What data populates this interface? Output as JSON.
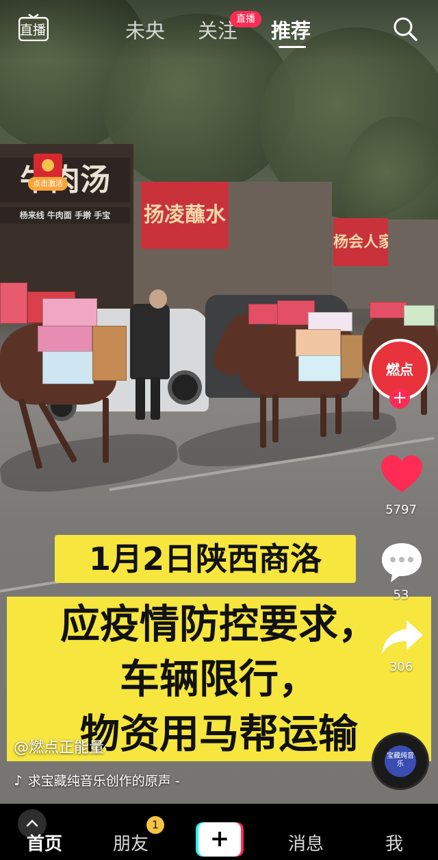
{
  "top_nav": {
    "live_tab_label": "直播",
    "tabs": [
      {
        "label": "未央"
      },
      {
        "label": "关注",
        "badge": "直播"
      },
      {
        "label": "推荐"
      }
    ],
    "active_tab": "推荐"
  },
  "video": {
    "store_signs": [
      "牛肉汤",
      "扬凌蘸水",
      "杨会人家"
    ],
    "store_subtext": "杨来线  牛肉面  手擀  手宝",
    "red_packet_tag": "点击激活",
    "caption_line1": "1月2日陕西商洛",
    "caption_lines": [
      "应疫情防控要求，",
      "车辆限行，",
      "物资用马帮运输"
    ]
  },
  "sidebar": {
    "author_avatar_text": "燃点",
    "likes": "5797",
    "comments": "53",
    "shares": "306",
    "music_disc_text": "宝藏纯音乐"
  },
  "info": {
    "author": "@燃点正能量",
    "music": "求宝藏纯音乐创作的原声 -"
  },
  "bottom_nav": {
    "tabs": [
      "首页",
      "朋友",
      "消息",
      "我"
    ],
    "friends_badge": "1",
    "active_tab": "首页"
  },
  "colors": {
    "accent": "#fe2c55",
    "caption_yellow": "#f6e63e",
    "avatar_red": "#e8323c"
  }
}
